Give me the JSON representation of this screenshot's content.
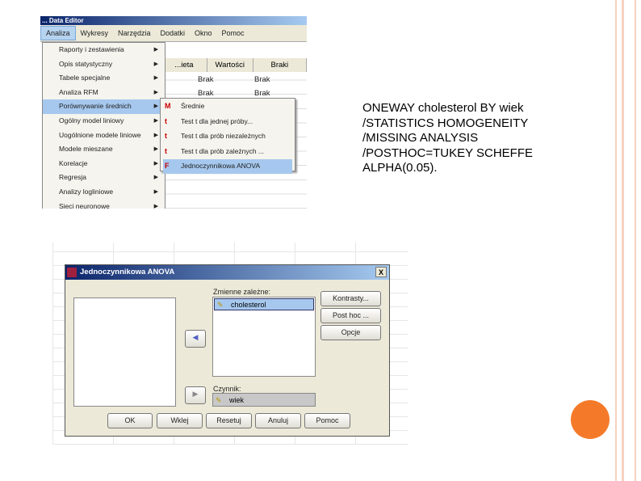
{
  "syntax": [
    "ONEWAY cholesterol BY wiek",
    "/STATISTICS HOMOGENEITY",
    "/MISSING ANALYSIS",
    "/POSTHOC=TUKEY SCHEFFE",
    "ALPHA(0.05)."
  ],
  "editor": {
    "title": "... Data Editor",
    "menubar": [
      "Analiza",
      "Wykresy",
      "Narzędzia",
      "Dodatki",
      "Okno",
      "Pomoc"
    ],
    "columns": [
      "...ieta",
      "Wartości",
      "Braki"
    ],
    "cells": [
      [
        "Brak",
        "Brak"
      ],
      [
        "Brak",
        "Brak"
      ]
    ],
    "menu": [
      "Raporty i zestawienia",
      "Opis statystyczny",
      "Tabele specjalne",
      "Analiza RFM",
      "Porównywanie średnich",
      "Ogólny model liniowy",
      "Uogólnione modele liniowe",
      "Modele mieszane",
      "Korelacje",
      "Regresja",
      "Analizy logliniowe",
      "Sieci neuronowe"
    ],
    "submenu": [
      "Średnie",
      "Test t dla jednej próby...",
      "Test t dla prób niezależnych",
      "Test t dla prób zależnych ...",
      "Jednoczynnikowa ANOVA"
    ]
  },
  "dialog": {
    "title": "Jednoczynnikowa ANOVA",
    "close": "X",
    "dep_label": "Zmienne zależne:",
    "dep_item": "cholesterol",
    "factor_label": "Czynnik:",
    "factor_item": "wiek",
    "side_buttons": [
      "Kontrasty...",
      "Post hoc ...",
      "Opcje"
    ],
    "bottom_buttons": [
      "OK",
      "Wklej",
      "Resetuj",
      "Anuluj",
      "Pomoc"
    ]
  },
  "colors": {
    "accent": "#f47a2a",
    "decor": "#f6d2c0",
    "highlight": "#a6c8ee"
  }
}
